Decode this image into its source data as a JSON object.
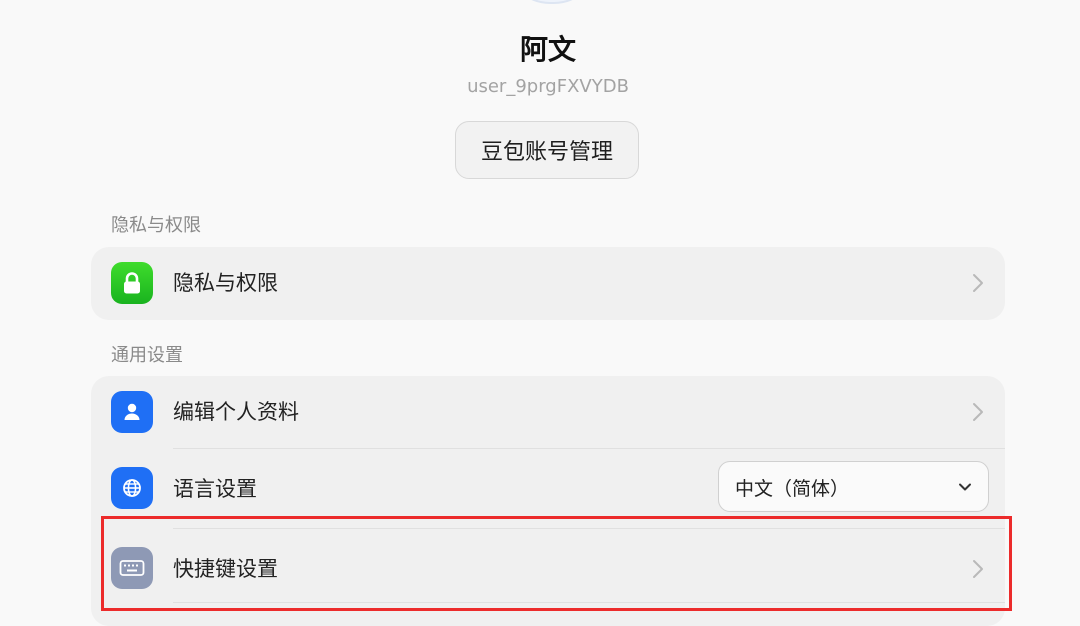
{
  "profile": {
    "name": "阿文",
    "user_id": "user_9prgFXVYDB",
    "account_button": "豆包账号管理"
  },
  "sections": {
    "privacy": {
      "title": "隐私与权限",
      "items": [
        {
          "label": "隐私与权限",
          "icon": "lock-icon",
          "icon_color": "#27c226"
        }
      ]
    },
    "general": {
      "title": "通用设置",
      "items": [
        {
          "label": "编辑个人资料",
          "icon": "person-icon",
          "icon_color": "#1f6ff5"
        },
        {
          "label": "语言设置",
          "icon": "globe-icon",
          "icon_color": "#1f6ff5",
          "selected_language": "中文（简体）"
        },
        {
          "label": "快捷键设置",
          "icon": "keyboard-icon",
          "icon_color": "#8e99b5"
        }
      ]
    }
  },
  "highlight_color": "#ec2b2b"
}
